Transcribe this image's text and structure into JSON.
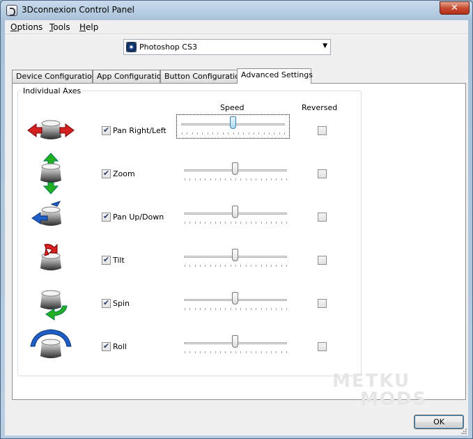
{
  "window": {
    "title": "3Dconnexion Control Panel",
    "close_glyph": "✕"
  },
  "menu": [
    {
      "label_u": "O",
      "label_rest": "ptions"
    },
    {
      "label_u": "T",
      "label_rest": "ools"
    },
    {
      "label_u": "H",
      "label_rest": "elp"
    }
  ],
  "app_select": {
    "value": "Photoshop CS3",
    "arrow": "▼"
  },
  "tabs": [
    {
      "label": "Device Configuration",
      "active": false
    },
    {
      "label": "App Configuration",
      "active": false
    },
    {
      "label": "Button Configuration",
      "active": false
    },
    {
      "label": "Advanced Settings",
      "active": true
    }
  ],
  "group": {
    "label": "Individual Axes"
  },
  "columns": {
    "speed": "Speed",
    "reversed": "Reversed"
  },
  "axes": [
    {
      "label": "Pan Right/Left",
      "enabled": true,
      "speed": 0.5,
      "reversed": false,
      "icon": "pan-right-left-icon",
      "focused": true
    },
    {
      "label": "Zoom",
      "enabled": true,
      "speed": 0.5,
      "reversed": false,
      "icon": "zoom-icon",
      "focused": false
    },
    {
      "label": "Pan Up/Down",
      "enabled": true,
      "speed": 0.5,
      "reversed": false,
      "icon": "pan-up-down-icon",
      "focused": false
    },
    {
      "label": "Tilt",
      "enabled": true,
      "speed": 0.5,
      "reversed": false,
      "icon": "tilt-icon",
      "focused": false
    },
    {
      "label": "Spin",
      "enabled": true,
      "speed": 0.5,
      "reversed": false,
      "icon": "spin-icon",
      "focused": false
    },
    {
      "label": "Roll",
      "enabled": true,
      "speed": 0.5,
      "reversed": false,
      "icon": "roll-icon",
      "focused": false
    }
  ],
  "buttons": {
    "ok": "OK"
  },
  "watermark": {
    "line1": "METKU",
    "line2": "MODS"
  },
  "colors": {
    "red": "#d42020",
    "green": "#22b022",
    "blue": "#1f5fc8",
    "focus_thumb": "#a8d8f3"
  }
}
